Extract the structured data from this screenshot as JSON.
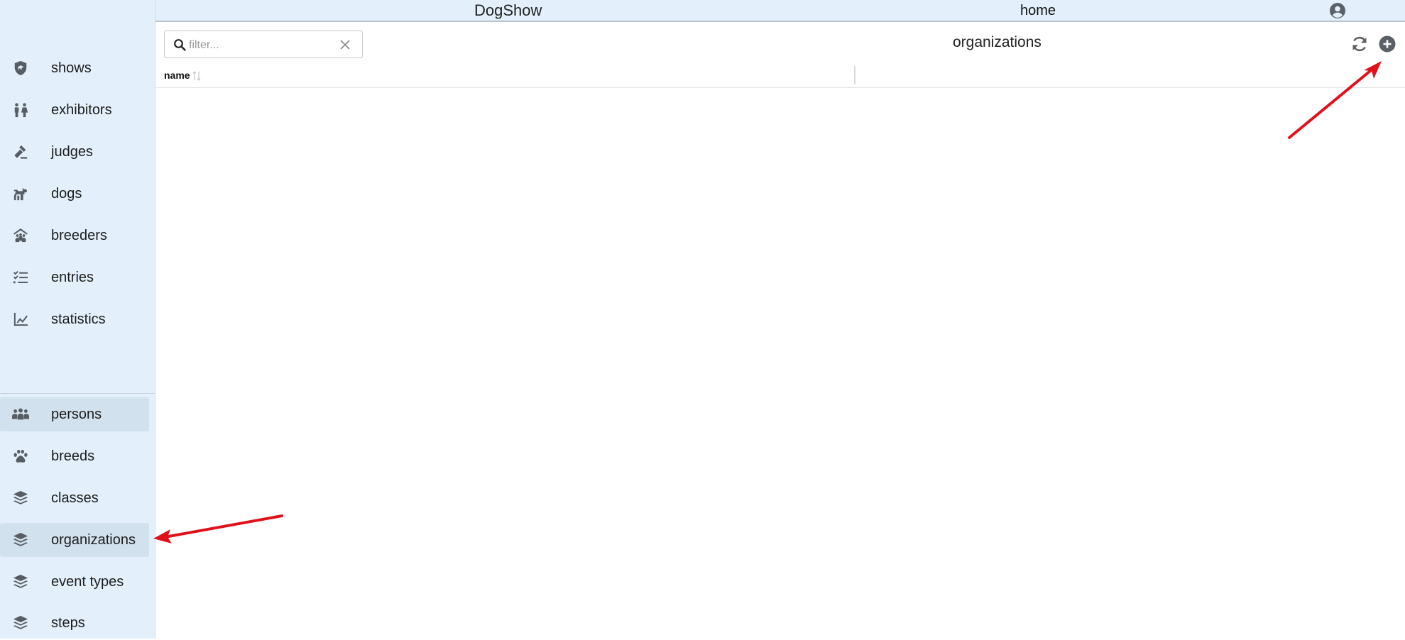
{
  "app": {
    "title": "DogShow",
    "home_label": "home"
  },
  "sidebar": {
    "main_items": [
      {
        "label": "shows",
        "icon": "shield-dog-icon"
      },
      {
        "label": "exhibitors",
        "icon": "people-icon"
      },
      {
        "label": "judges",
        "icon": "gavel-icon"
      },
      {
        "label": "dogs",
        "icon": "dog-icon"
      },
      {
        "label": "breeders",
        "icon": "house-people-icon"
      },
      {
        "label": "entries",
        "icon": "checklist-icon"
      },
      {
        "label": "statistics",
        "icon": "line-chart-icon"
      }
    ],
    "admin_items": [
      {
        "label": "persons",
        "icon": "persons-icon",
        "active": true
      },
      {
        "label": "breeds",
        "icon": "paw-icon"
      },
      {
        "label": "classes",
        "icon": "layers-icon"
      },
      {
        "label": "organizations",
        "icon": "layers-icon",
        "active": true
      },
      {
        "label": "event types",
        "icon": "layers-icon"
      },
      {
        "label": "steps",
        "icon": "layers-icon"
      }
    ]
  },
  "toolbar": {
    "filter_placeholder": "filter...",
    "filter_value": ""
  },
  "page": {
    "title": "organizations"
  },
  "table": {
    "columns": [
      "name"
    ],
    "rows": []
  },
  "colors": {
    "sidebar_bg": "#e3f0fb",
    "active_item_bg": "#d2e1ee",
    "icon": "#575d63",
    "annotation_arrow": "#e0111b"
  }
}
